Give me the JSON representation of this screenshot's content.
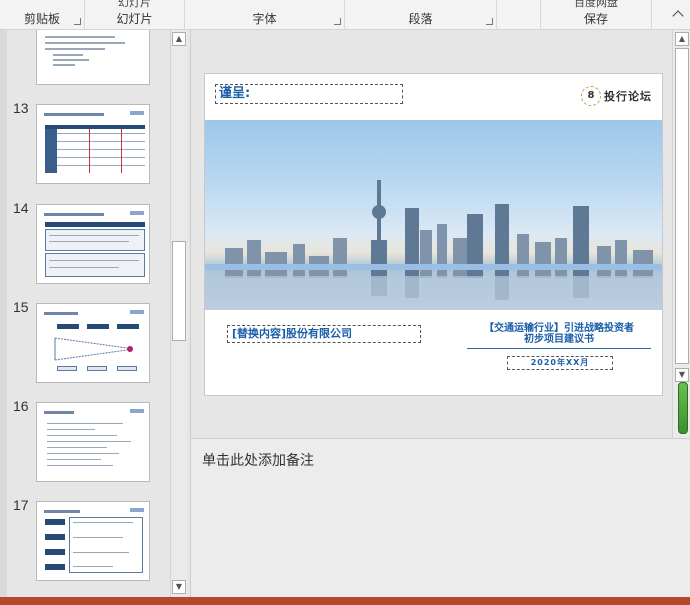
{
  "ribbon": {
    "groups": [
      {
        "label": "剪贴板"
      },
      {
        "label": "幻灯片",
        "top": "幻灯片"
      },
      {
        "label": "字体"
      },
      {
        "label": "段落"
      },
      {
        "label": "保存",
        "top": "百度网盘"
      }
    ]
  },
  "thumbnails": [
    {
      "number": "13"
    },
    {
      "number": "14"
    },
    {
      "number": "15"
    },
    {
      "number": "16"
    },
    {
      "number": "17"
    }
  ],
  "slide": {
    "salutation": "谨呈:",
    "brand_mark": "8",
    "brand_name": "投行论坛",
    "company": "[替换内容]股份有限公司",
    "project_line1": "【交通运输行业】引进战略投资者",
    "project_line2": "初步项目建议书",
    "date": "2020年XX月"
  },
  "notes": {
    "placeholder": "单击此处添加备注"
  },
  "colors": {
    "accent_blue": "#1a5ea8",
    "status_bar": "#b7472a"
  }
}
